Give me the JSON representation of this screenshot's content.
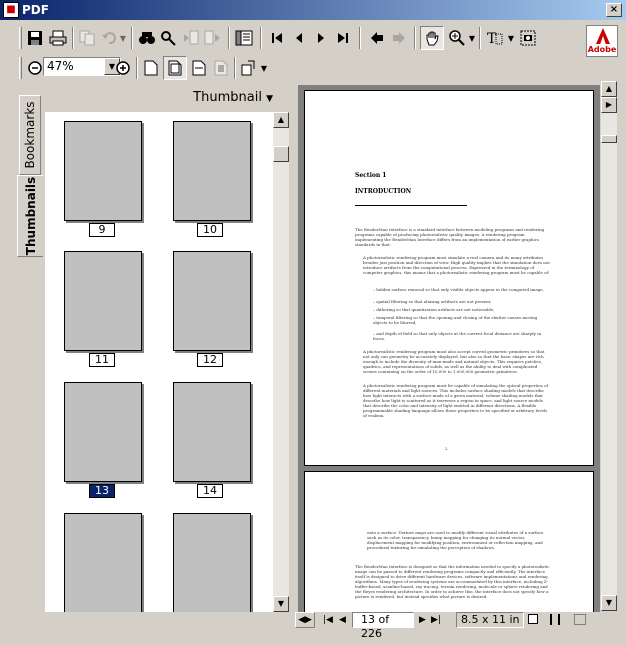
{
  "window": {
    "title": "PDF",
    "close_label": "×"
  },
  "toolbar": {
    "zoom_value": "47%",
    "adobe_logo_text": "Adobe"
  },
  "nav": {
    "tabs": [
      {
        "label": "Bookmarks"
      },
      {
        "label": "Thumbnails"
      }
    ],
    "panel_title": "Thumbnail",
    "thumbnails": [
      {
        "label": "9",
        "selected": false
      },
      {
        "label": "10",
        "selected": false
      },
      {
        "label": "11",
        "selected": false
      },
      {
        "label": "12",
        "selected": false
      },
      {
        "label": "13",
        "selected": true
      },
      {
        "label": "14",
        "selected": false
      },
      {
        "label": "",
        "selected": false
      },
      {
        "label": "",
        "selected": false
      }
    ]
  },
  "document": {
    "section": "Section 1",
    "heading": "INTRODUCTION",
    "intro": "The RenderMan Interface is a standard interface between modeling programs and rendering programs capable of producing photorealistic quality images. A rendering program implementing the RenderMan Interface differs from an implementation of earlier graphics standards in that:",
    "bullet1": "A photorealistic rendering program must simulate a real camera and its many attributes besides just position and direction of view. High quality implies that the simulation does not introduce artifacts from the computational process. Expressed in the terminology of computer graphics, this means that a photorealistic rendering program must be capable of:",
    "subbullets": [
      "– hidden surface removal so that only visible objects appear in the computed image,",
      "– spatial filtering so that aliasing artifacts are not present,",
      "– dithering so that quantization artifacts are not noticeable,",
      "– temporal filtering so that the opening and closing of the shutter causes moving objects to be blurred,",
      "– and depth of field so that only objects at the current focal distance are sharply in focus."
    ],
    "bullet2": "A photorealistic rendering program must also accept curved geometric primitives so that not only can geometry be accurately displayed, but also so that the basic shapes are rich enough to include the diversity of man-made and natural objects. This requires patches, quadrics, and representations of solids, as well as the ability to deal with complicated scenes containing on the order of 10,000 to 1,000,000 geometric primitives.",
    "bullet3": "A photorealistic rendering program must be capable of simulating the optical properties of different materials and light sources. This includes surface shading models that describe how light interacts with a surface made of a given material, volume shading models that describe how light is scattered as it traverses a region in space, and light source models that describe the color and intensity of light emitted in different directions. A flexible programmable shading language allows these properties to be specified at arbitrary levels of realism.",
    "page_number": "2",
    "page2_p1": "onto a surface. Texture maps are used to modify different visual attributes of a surface such as its color, transparency, bump mapping for changing its normal vector, displacement mapping for modifying position, environment or reflection mapping, and procedural texturing for simulating the perception of shadows.",
    "page2_p2": "The RenderMan Interface is designed so that the information needed to specify a photorealistic image can be passed to different rendering programs compactly and efficiently. The interface itself is designed to drive different hardware devices, software implementations and rendering algorithms. Many types of rendering systems are accommodated by this interface, including Z-buffer-based, scanline-based, ray tracing, terrain rendering, molecule or sphere rendering and the Reyes rendering architecture. In order to achieve this, the interface does not specify how a picture is rendered, but instead specifies what picture is desired."
  },
  "status": {
    "page_indicator": "13 of 226",
    "page_size": "8.5 x 11 in"
  }
}
